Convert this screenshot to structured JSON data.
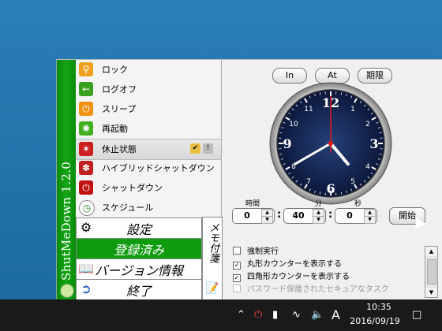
{
  "app": {
    "title": "ShutMeDown 1.2.0"
  },
  "menu": [
    {
      "label": "ロック",
      "icon": "lock-icon",
      "color": "#f0a020"
    },
    {
      "label": "ログオフ",
      "icon": "logoff-icon",
      "color": "#3aa020"
    },
    {
      "label": "スリープ",
      "icon": "sleep-icon",
      "color": "#f09010"
    },
    {
      "label": "再起動",
      "icon": "restart-icon",
      "color": "#40b020"
    },
    {
      "label": "休止状態",
      "icon": "hibernate-icon",
      "color": "#cc2020"
    },
    {
      "label": "ハイブリッドシャットダウン",
      "icon": "hybrid-shutdown-icon",
      "color": "#c02020"
    },
    {
      "label": "シャットダウン",
      "icon": "shutdown-icon",
      "color": "#c01010"
    },
    {
      "label": "スケジュール",
      "icon": "schedule-icon",
      "color": "#ffffff"
    }
  ],
  "bottom_buttons": {
    "settings": "設定",
    "registered": "登録済み",
    "version": "バージョン情報",
    "exit": "終了"
  },
  "notes_tab": "メモ付箋",
  "timer_tabs": {
    "in": "In",
    "at": "At",
    "deadline": "期限"
  },
  "time_labels": {
    "hours": "時間",
    "minutes": "分",
    "seconds": "秒"
  },
  "time_values": {
    "hours": "0",
    "minutes": "40",
    "seconds": "0"
  },
  "start_label": "開始",
  "options": [
    {
      "label": "強制実行",
      "checked": false,
      "disabled": false
    },
    {
      "label": "丸形カウンターを表示する",
      "checked": true,
      "disabled": false
    },
    {
      "label": "四角形カウンターを表示する",
      "checked": true,
      "disabled": false
    },
    {
      "label": "パスワード保護されたセキュアなタスク",
      "checked": false,
      "disabled": true
    }
  ],
  "analog_clock": {
    "hour": 4,
    "minute": 40,
    "second": 0
  },
  "taskbar": {
    "time": "10:35",
    "date": "2016/09/19",
    "ime": "A"
  },
  "colors": {
    "accent_green": "#0e9b0e",
    "clock_face": "#0f1f4a"
  }
}
